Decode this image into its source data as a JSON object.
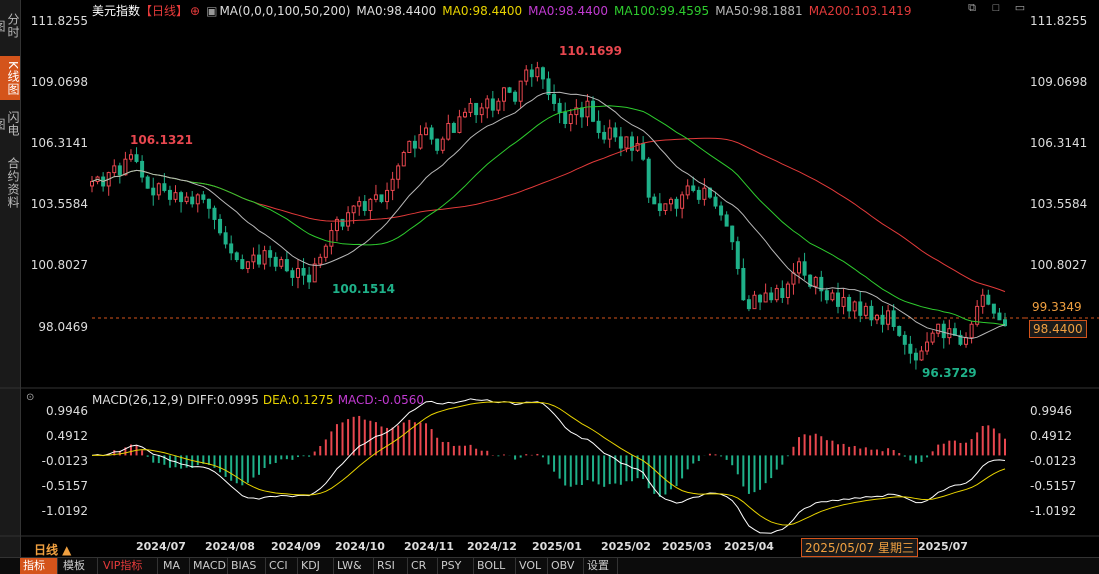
{
  "sidebar": {
    "tabs": [
      {
        "label": "分时图",
        "active": false
      },
      {
        "label": "K线图",
        "active": true
      },
      {
        "label": "闪电图",
        "active": false
      },
      {
        "label": "合约资料",
        "active": false
      }
    ]
  },
  "header": {
    "title": "美元指数",
    "period_tag": "【日线】",
    "ma_params": "MA(0,0,0,100,50,200)",
    "ma": "MA0:98.4400",
    "ma1": "MA0:98.4400",
    "ma2": "MA0:98.4400",
    "ma100": "MA100:99.4595",
    "ma50": "MA50:98.1881",
    "ma200": "MA200:103.1419"
  },
  "price_axis": [
    "111.8255",
    "109.0698",
    "106.3141",
    "103.5584",
    "100.8027",
    "98.0469"
  ],
  "price_tags": {
    "last": "99.3349",
    "ma": "98.4400"
  },
  "annotations": {
    "high_mid": "106.1321",
    "high": "110.1699",
    "low_a": "100.1514",
    "low_b": "96.3729"
  },
  "macd": {
    "params": "MACD(26,12,9)",
    "diff": "DIFF:0.0995",
    "dea": "DEA:0.1275",
    "macd": "MACD:-0.0560",
    "axis": [
      "0.9946",
      "0.4912",
      "-0.0123",
      "-0.5157",
      "-1.0192"
    ]
  },
  "time_axis": [
    "2024/07",
    "2024/08",
    "2024/09",
    "2024/10",
    "2024/11",
    "2024/12",
    "2025/01",
    "2025/02",
    "2025/03",
    "2025/04",
    "2025/07"
  ],
  "crosshair_date": "2025/05/07 星期三",
  "period_label": "日线 ▲",
  "toolbar": [
    "指标",
    "模板",
    "VIP指标",
    "MA",
    "MACD",
    "BIAS",
    "CCI",
    "KDJ",
    "LW&",
    "RSI",
    "CR",
    "PSY",
    "BOLL",
    "VOL",
    "OBV",
    "设置"
  ],
  "colors": {
    "up": "#e8474f",
    "down": "#1fb189",
    "ma100": "#2ecc2e",
    "ma50": "#b8b8b8",
    "ma200": "#e23a3a",
    "accent": "#d4541b",
    "diff": "#ffffff",
    "dea": "#e8d300",
    "macd_label": "#c03ad0"
  },
  "chart_data": {
    "type": "candlestick",
    "series_close": [
      104.9,
      105.1,
      104.7,
      105.3,
      105.6,
      105.2,
      105.9,
      106.1,
      105.8,
      105.1,
      104.6,
      104.3,
      104.8,
      104.5,
      104.1,
      104.4,
      104.0,
      104.2,
      103.9,
      104.3,
      104.1,
      103.7,
      103.2,
      102.6,
      102.1,
      101.7,
      101.4,
      101.0,
      101.3,
      101.6,
      101.2,
      101.8,
      101.5,
      101.1,
      101.4,
      100.9,
      100.6,
      101.0,
      100.7,
      100.4,
      101.2,
      101.5,
      102.0,
      102.7,
      103.2,
      102.9,
      103.5,
      103.8,
      104.0,
      103.6,
      104.1,
      104.3,
      104.0,
      104.5,
      105.0,
      105.6,
      106.2,
      106.7,
      106.4,
      107.0,
      107.3,
      106.8,
      106.3,
      106.8,
      107.5,
      107.1,
      107.8,
      108.0,
      108.4,
      107.9,
      108.2,
      108.6,
      108.1,
      108.5,
      109.1,
      108.9,
      108.5,
      109.4,
      109.9,
      109.6,
      110.0,
      109.5,
      108.8,
      108.4,
      108.0,
      107.5,
      107.9,
      108.2,
      107.8,
      108.5,
      107.6,
      107.1,
      106.8,
      107.3,
      106.9,
      106.4,
      106.9,
      106.3,
      106.6,
      105.9,
      104.2,
      103.9,
      103.6,
      103.9,
      104.1,
      103.7,
      104.3,
      104.7,
      104.5,
      104.1,
      104.6,
      104.2,
      103.8,
      103.4,
      102.9,
      102.2,
      101.0,
      99.6,
      99.2,
      99.8,
      99.5,
      99.9,
      99.6,
      100.1,
      99.7,
      100.3,
      100.8,
      101.3,
      100.7,
      100.2,
      100.6,
      100.0,
      99.6,
      99.9,
      99.3,
      99.7,
      99.1,
      99.5,
      98.9,
      99.3,
      98.7,
      98.9,
      98.5,
      99.1,
      98.4,
      98.0,
      97.6,
      97.2,
      96.9,
      97.3,
      97.7,
      98.1,
      98.5,
      97.9,
      98.3,
      98.0,
      97.6,
      97.9,
      98.5,
      99.3,
      99.8,
      99.4,
      99.0,
      98.7,
      98.44
    ],
    "ylim": [
      96.0,
      112.5
    ],
    "legend": "top-left"
  }
}
